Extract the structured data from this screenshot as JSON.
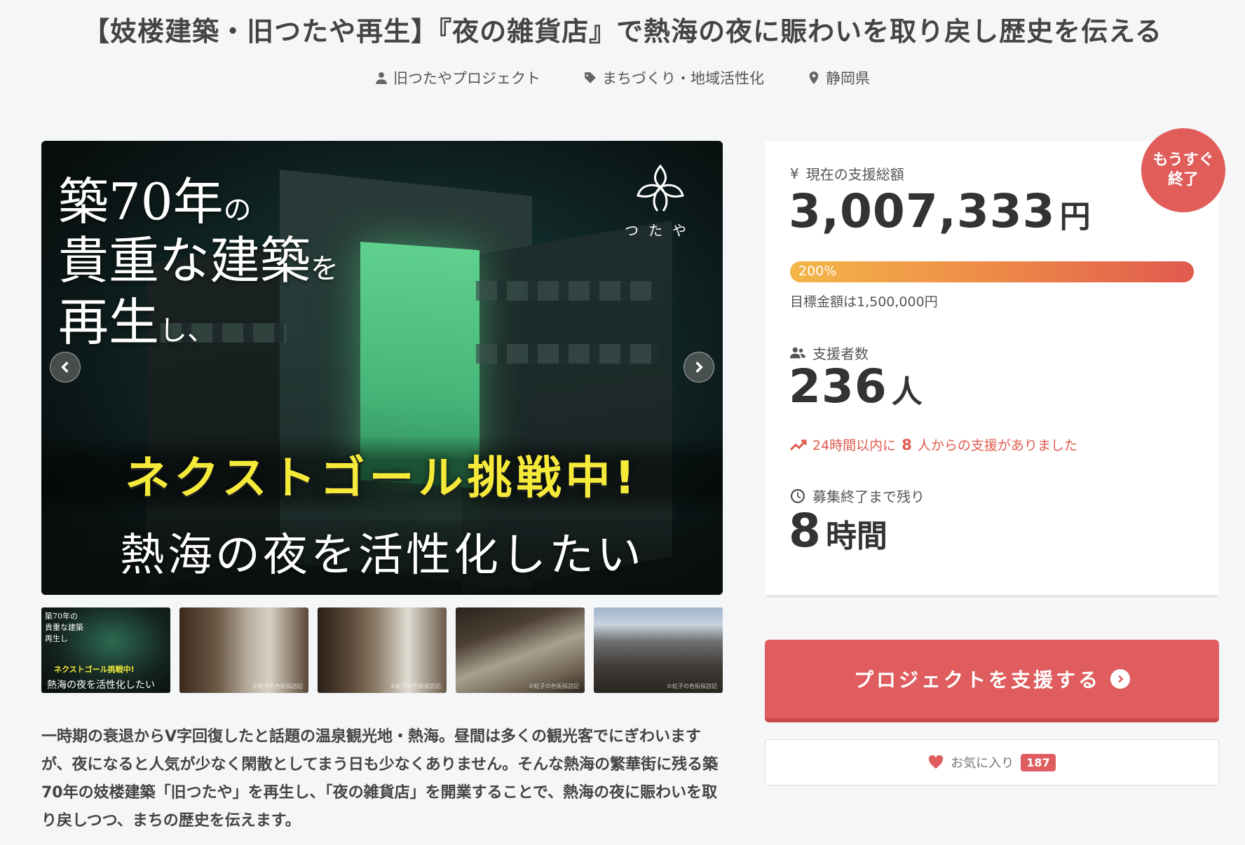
{
  "title": "【妓楼建築・旧つたや再生】『夜の雑貨店』で熱海の夜に賑わいを取り戻し歴史を伝える",
  "meta": {
    "owner": "旧つたやプロジェクト",
    "category": "まちづくり・地域活性化",
    "location": "静岡県"
  },
  "hero": {
    "line1_big": "築70年",
    "line1_small": "の",
    "line2_big": "貴重な建築",
    "line2_small": "を",
    "line3_big": "再生",
    "line3_small": "し、",
    "banner": "ネクストゴール挑戦中!",
    "subline": "熱海の夜を活性化したい",
    "logo_text": "つたや"
  },
  "thumbnails": [
    {
      "label_line1": "築70年の",
      "label_line2": "貴重な建築",
      "label_line3": "再生し",
      "label_banner": "ネクストゴール挑戦中!",
      "label_sub": "熱海の夜を活性化したい"
    },
    {
      "credit": "©紅子の色街探訪記"
    },
    {
      "credit": "©紅子の色街探訪記"
    },
    {
      "credit": "©紅子の色街探訪記"
    },
    {
      "credit": "©紅子の色街探訪記"
    }
  ],
  "description": "一時期の衰退からV字回復したと話題の温泉観光地・熱海。昼間は多くの観光客でにぎわいますが、夜になると人気が少なく閑散としてまう日も少なくありません。そんな熱海の繁華街に残る築70年の妓楼建築「旧つたや」を再生し、「夜の雑貨店」を開業することで、熱海の夜に賑わいを取り戻しつつ、まちの歴史を伝えます。",
  "stats": {
    "badge_line1": "もうすぐ",
    "badge_line2": "終了",
    "total_label": "現在の支援総額",
    "total_amount": "3,007,333",
    "total_unit": "円",
    "progress_percent": 200,
    "progress_label": "200%",
    "goal_text": "目標金額は1,500,000円",
    "supporters_label": "支援者数",
    "supporters_count": "236",
    "supporters_unit": "人",
    "trend_prefix": "24時間以内に",
    "trend_count": "8",
    "trend_suffix": "人からの支援がありました",
    "remaining_label": "募集終了まで残り",
    "remaining_value": "8",
    "remaining_unit": "時間"
  },
  "actions": {
    "support_label": "プロジェクトを支援する",
    "favorite_label": "お気に入り",
    "favorite_count": "187"
  },
  "colors": {
    "accent": "#e05d5f",
    "progress_start": "#f3b648",
    "progress_end": "#e05a4e",
    "hero_banner": "#f5ea3a"
  }
}
